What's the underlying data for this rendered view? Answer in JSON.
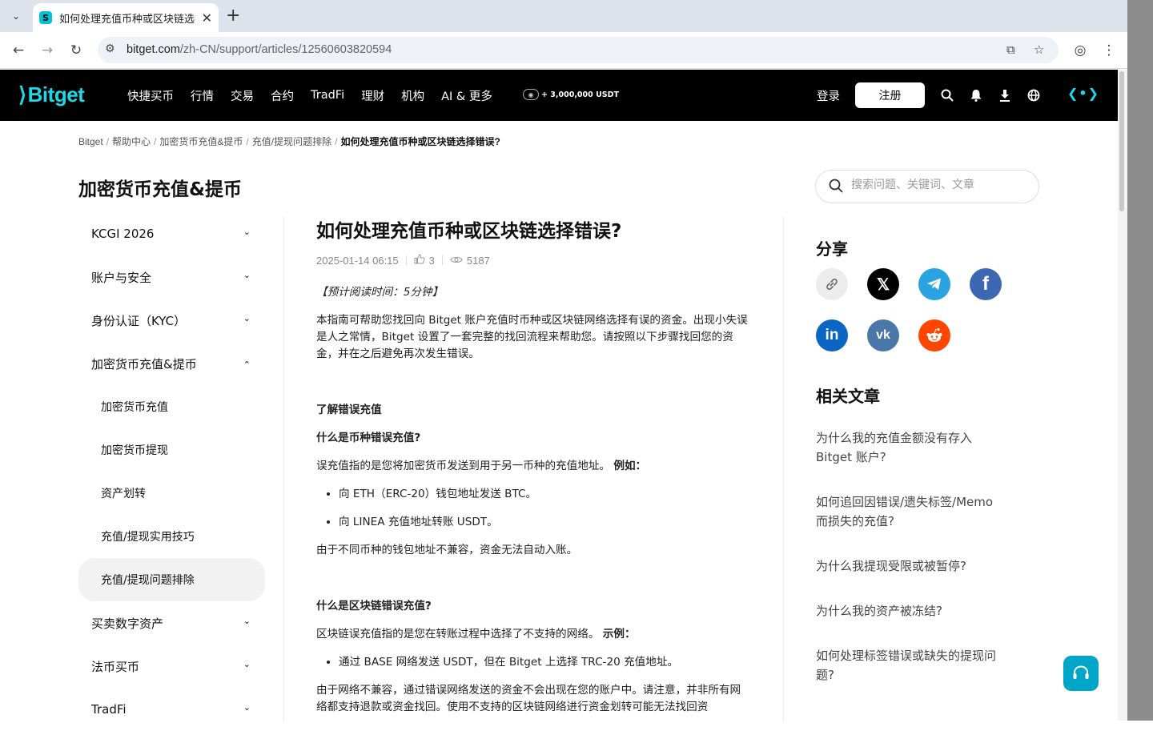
{
  "browser": {
    "tab_title": "如何处理充值币种或区块链选择错误?",
    "url_host": "bitget.com",
    "url_path": "/zh-CN/support/articles/12560603820594"
  },
  "header": {
    "logo": "Bitget",
    "nav": [
      "快捷买币",
      "行情",
      "交易",
      "合约",
      "TradFi",
      "理财",
      "机构",
      "AI & 更多"
    ],
    "promo": "+ 3,000,000 USDT",
    "login": "登录",
    "signup": "注册"
  },
  "breadcrumb": [
    "Bitget",
    "帮助中心",
    "加密货币充值&提币",
    "充值/提现问题排除",
    "如何处理充值币种或区块链选择错误?"
  ],
  "section_title": "加密货币充值&提币",
  "search": {
    "placeholder": "搜索问题、关键词、文章"
  },
  "sidebar": {
    "items": [
      {
        "label": "KCGI 2026"
      },
      {
        "label": "账户与安全"
      },
      {
        "label": "身份认证（KYC）"
      },
      {
        "label": "加密货币充值&提币"
      }
    ],
    "sub_items": [
      "加密货币充值",
      "加密货币提现",
      "资产划转",
      "充值/提现实用技巧",
      "充值/提现问题排除"
    ],
    "items_after": [
      {
        "label": "买卖数字资产"
      },
      {
        "label": "法币买币"
      },
      {
        "label": "TradFi"
      }
    ]
  },
  "article": {
    "title": "如何处理充值币种或区块链选择错误?",
    "date": "2025-01-14 06:15",
    "likes": "3",
    "views": "5187",
    "reading_time": "【预计阅读时间：5分钟】",
    "intro": "本指南可帮助您找回向 Bitget 账户充值时币种或区块链网络选择有误的资金。出现小失误是人之常情，Bitget 设置了一套完整的找回流程来帮助您。请按照以下步骤找回您的资金，并在之后避免再次发生错误。",
    "h_understand": "了解错误充值",
    "h_coin": "什么是币种错误充值?",
    "coin_desc": "误充值指的是您将加密货币发送到用于另一币种的充值地址。",
    "coin_example_label": "例如：",
    "coin_examples": [
      "向 ETH（ERC-20）钱包地址发送 BTC。",
      "向 LINEA 充值地址转账 USDT。"
    ],
    "coin_conclusion": "由于不同币种的钱包地址不兼容，资金无法自动入账。",
    "h_chain": "什么是区块链错误充值?",
    "chain_desc": "区块链误充值指的是您在转账过程中选择了不支持的网络。",
    "chain_example_label": "示例：",
    "chain_examples": [
      "通过 BASE 网络发送 USDT，但在 Bitget 上选择 TRC-20 充值地址。"
    ],
    "chain_conclusion": "由于网络不兼容，通过错误网络发送的资金不会出现在您的账户中。请注意，并非所有网络都支持退款或资金找回。使用不支持的区块链网络进行资金划转可能无法找回资"
  },
  "share": {
    "title": "分享",
    "icons": [
      "link-icon",
      "x-icon",
      "telegram-icon",
      "facebook-icon",
      "linkedin-icon",
      "vk-icon",
      "reddit-icon"
    ]
  },
  "related": {
    "title": "相关文章",
    "links": [
      "为什么我的充值金额没有存入 Bitget 账户?",
      "如何追回因错误/遗失标签/Memo 而损失的充值?",
      "为什么我提现受限或被暂停?",
      "为什么我的资产被冻结?",
      "如何处理标签错误或缺失的提现问题?"
    ]
  },
  "colors": {
    "brand": "#1bd9e8",
    "support": "#00a6c7",
    "telegram": "#2aa3e0",
    "facebook": "#3d67b1",
    "linkedin": "#0a66c2",
    "vk": "#4a76a8",
    "reddit": "#ff4500"
  }
}
